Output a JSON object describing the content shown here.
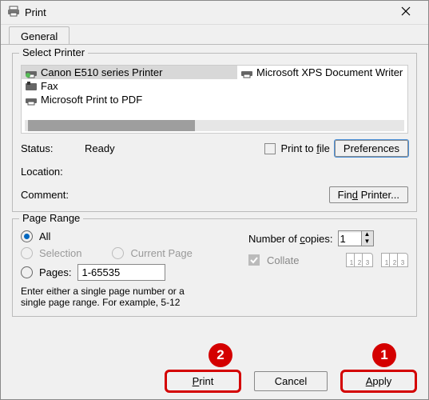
{
  "window": {
    "title": "Print"
  },
  "tabs": {
    "general": "General"
  },
  "selectPrinter": {
    "legend": "Select Printer",
    "items": [
      {
        "label": "Canon E510 series Printer",
        "selected": true
      },
      {
        "label": "Fax",
        "selected": false
      },
      {
        "label": "Microsoft Print to PDF",
        "selected": false
      },
      {
        "label": "Microsoft XPS Document Writer",
        "selected": false
      }
    ],
    "status_label": "Status:",
    "status_value": "Ready",
    "location_label": "Location:",
    "location_value": "",
    "comment_label": "Comment:",
    "comment_value": "",
    "print_to_file": "Print to file",
    "print_to_file_underline": "f",
    "print_to_file_checked": false,
    "preferences": "Preferences",
    "find_printer": "Find Printer...",
    "find_printer_underline": "d"
  },
  "pageRange": {
    "legend": "Page Range",
    "all": "All",
    "selection": "Selection",
    "current_page": "Current Page",
    "pages": "Pages:",
    "pages_input": "1-65535",
    "hint_line1": "Enter either a single page number or a",
    "hint_line2": "single page range.  For example, 5-12",
    "option": "all",
    "copies_label": "Number of copies:",
    "copies_underline": "c",
    "copies_value": "1",
    "collate": "Collate",
    "collate_checked": true
  },
  "buttons": {
    "print": "Print",
    "cancel": "Cancel",
    "apply": "Apply"
  },
  "callouts": {
    "print": "2",
    "apply": "1"
  }
}
